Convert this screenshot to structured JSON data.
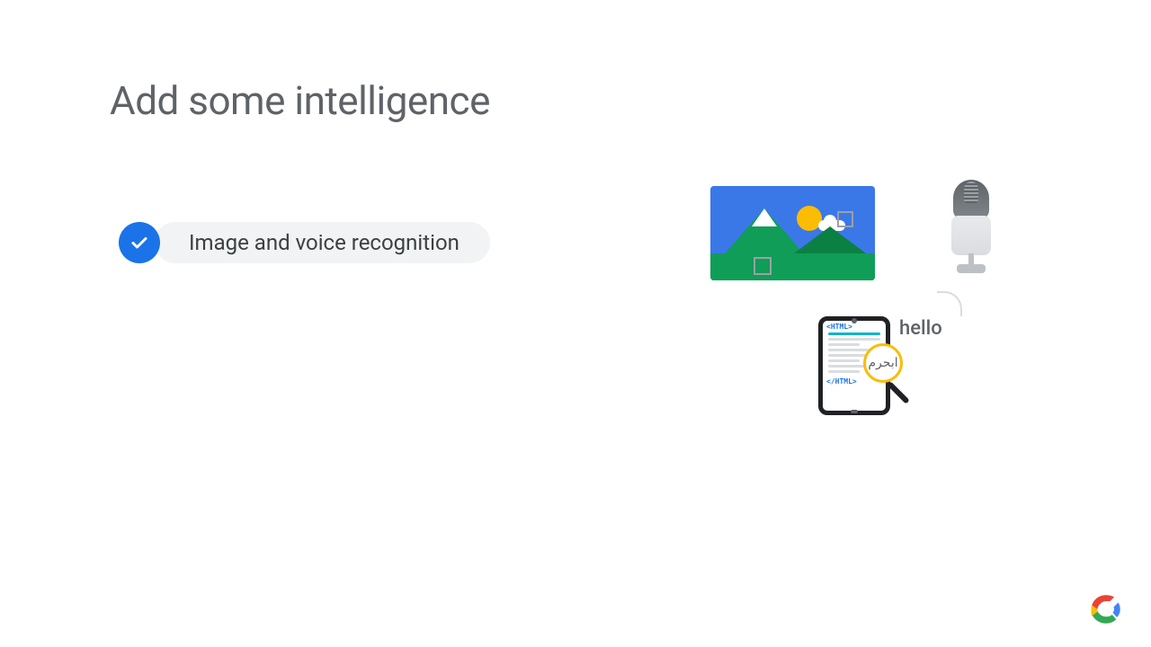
{
  "title": "Add some intelligence",
  "bullets": [
    "Image and voice recognition"
  ],
  "illustrations": {
    "image_recognition": {
      "icon": "landscape-photo-icon"
    },
    "voice_recognition": {
      "icon": "microphone-icon"
    },
    "translation": {
      "icon": "tablet-magnifier-icon",
      "tag_open": "<HTML>",
      "tag_close": "</HTML>",
      "source_text": "ابحرم",
      "output_text": "hello"
    }
  },
  "branding": {
    "logo": "google-cloud"
  }
}
